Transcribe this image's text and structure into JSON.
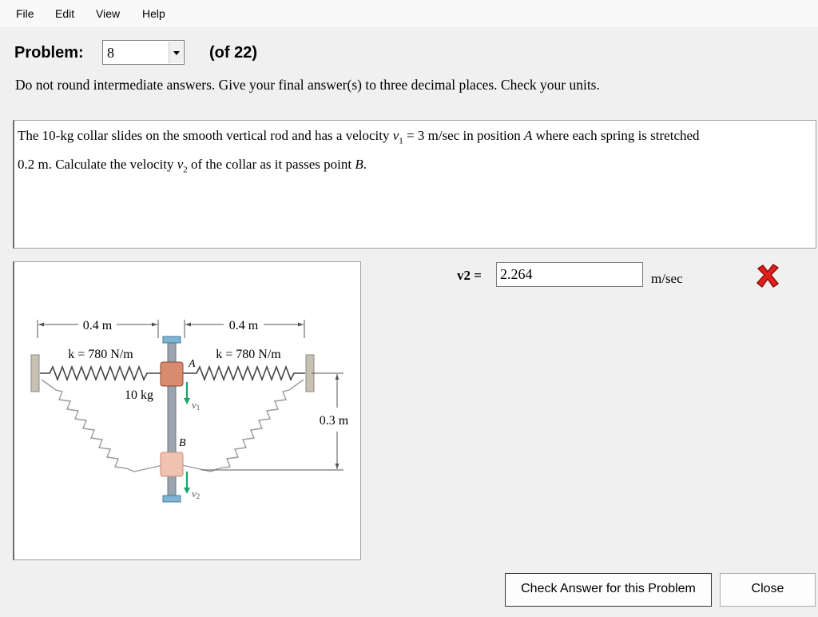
{
  "menu": {
    "items": [
      "File",
      "Edit",
      "View",
      "Help"
    ]
  },
  "problem": {
    "label": "Problem:",
    "selected": "8",
    "of_text": "(of 22)"
  },
  "instructions": "Do not round intermediate answers.  Give your final answer(s) to three decimal places.  Check your units.",
  "statement": {
    "line1_part1": "The 10-kg collar slides on the smooth vertical rod and has a velocity ",
    "v1_symbol": "v",
    "v1_sub": "1",
    "line1_part2": " = 3 m/sec in position ",
    "pos_a": "A",
    "line1_part3": " where each spring is stretched",
    "line2_part1": "0.2 m. Calculate the velocity ",
    "v2_symbol": "v",
    "v2_sub": "2",
    "line2_part2": " of the collar as it passes point ",
    "pos_b": "B",
    "line2_part3": "."
  },
  "figure": {
    "left_dim": "0.4 m",
    "right_dim": "0.4 m",
    "left_k": "k = 780 N/m",
    "right_k": "k = 780 N/m",
    "mass": "10 kg",
    "label_a": "A",
    "label_b": "B",
    "v1_label": "v",
    "v1_sub": "1",
    "v2_label": "v",
    "v2_sub": "2",
    "vertical_dim": "0.3 m"
  },
  "answer": {
    "label": "v2 =",
    "value": "2.264",
    "unit": "m/sec",
    "status": "incorrect",
    "status_color": "#e0201c"
  },
  "buttons": {
    "check": "Check Answer for this Problem",
    "close": "Close"
  }
}
